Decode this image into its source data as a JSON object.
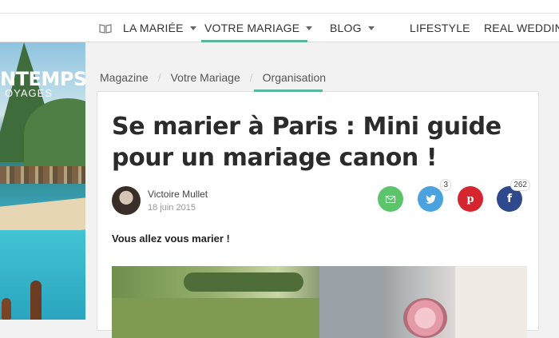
{
  "nav": {
    "items": [
      {
        "label": "LA MARIÉE",
        "has_dropdown": true
      },
      {
        "label": "VOTRE MARIAGE",
        "has_dropdown": true,
        "active": true
      },
      {
        "label": "BLOG",
        "has_dropdown": true
      },
      {
        "label": "LIFESTYLE",
        "has_dropdown": false
      },
      {
        "label": "REAL WEDDIN",
        "has_dropdown": false
      }
    ],
    "icon": "book-icon",
    "accent_color": "#5bb59a"
  },
  "ad": {
    "title": "NTEMPS",
    "subtitle": "OYAGES"
  },
  "breadcrumb": {
    "items": [
      "Magazine",
      "Votre Mariage",
      "Organisation"
    ],
    "separator": "/"
  },
  "article": {
    "title": "Se marier à Paris : Mini guide pour un mariage canon !",
    "author": "Victoire Mullet",
    "date": "18 juin 2015",
    "lead": "Vous allez vous marier !"
  },
  "share": [
    {
      "network": "email",
      "icon": "mail-icon",
      "color": "#5cc46a",
      "count": ""
    },
    {
      "network": "twitter",
      "icon": "twitter-icon",
      "color": "#4aa3df",
      "count": "3"
    },
    {
      "network": "pinterest",
      "icon": "pinterest-icon",
      "color": "#d5262f",
      "count": ""
    },
    {
      "network": "facebook",
      "icon": "facebook-icon",
      "color": "#2f4a8c",
      "count": "262"
    }
  ]
}
